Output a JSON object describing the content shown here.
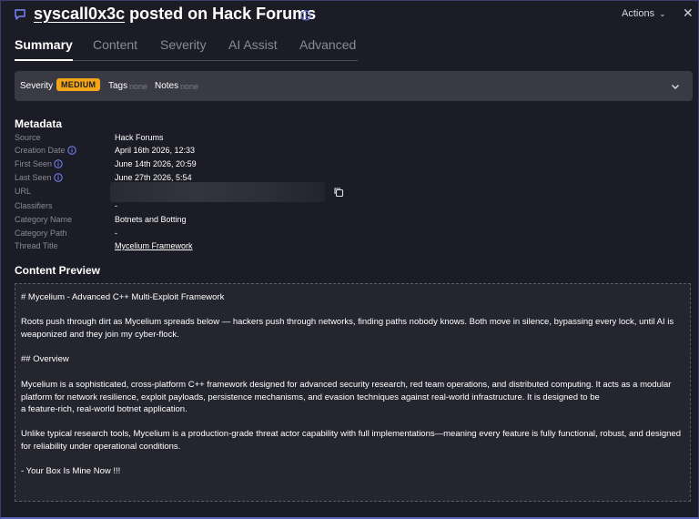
{
  "header": {
    "author": "syscall0x3c",
    "title_rest": " posted on Hack Forums",
    "actions_label": "Actions",
    "close_label": "✕"
  },
  "tabs": [
    {
      "label": "Summary",
      "active": true
    },
    {
      "label": "Content",
      "active": false
    },
    {
      "label": "Severity",
      "active": false
    },
    {
      "label": "AI Assist",
      "active": false
    },
    {
      "label": "Advanced",
      "active": false
    }
  ],
  "severity_bar": {
    "severity_label": "Severity",
    "severity_value": "MEDIUM",
    "tags_label": "Tags",
    "tags_value": "none",
    "notes_label": "Notes",
    "notes_value": "none",
    "badge_color": "#f2a516"
  },
  "metadata": {
    "title": "Metadata",
    "rows": [
      {
        "key": "Source",
        "value": "Hack Forums"
      },
      {
        "key": "Creation Date",
        "value": "April 16th 2026, 12:33"
      },
      {
        "key": "First Seen",
        "value": "June 14th 2026, 20:59"
      },
      {
        "key": "Last Seen",
        "value": "June 27th 2026, 5:54"
      },
      {
        "key": "URL",
        "value": ""
      },
      {
        "key": "Classifiers",
        "value": "-"
      },
      {
        "key": "Category Name",
        "value": "Botnets and Botting"
      },
      {
        "key": "Category Path",
        "value": "-"
      },
      {
        "key": "Thread Title",
        "value": "Mycelium Framework"
      }
    ]
  },
  "content_preview": {
    "title": "Content Preview",
    "paragraphs": [
      "# Mycelium - Advanced C++ Multi-Exploit Framework",
      "Roots push through dirt as Mycelium spreads below — hackers push through networks, finding paths nobody knows. Both move in silence, bypassing every lock, until AI is weaponized and they join my cyber-flock.",
      "## Overview",
      "Mycelium is a sophisticated, cross-platform C++ framework designed for advanced security research, red team operations, and distributed computing. It acts as a modular platform for network resilience, exploit payloads, persistence mechanisms, and evasion techniques against real-world infrastructure. It is designed to be",
      "a feature-rich, real-world botnet application.",
      "Unlike typical research tools, Mycelium is a production-grade threat actor capability with full implementations—meaning every feature is fully functional, robust, and designed for reliability under operational conditions.",
      "- Your Box Is Mine Now !!!"
    ]
  },
  "colors": {
    "background": "#1c1c26",
    "accent": "#5a63b8",
    "muted_text": "#8a8a96"
  }
}
